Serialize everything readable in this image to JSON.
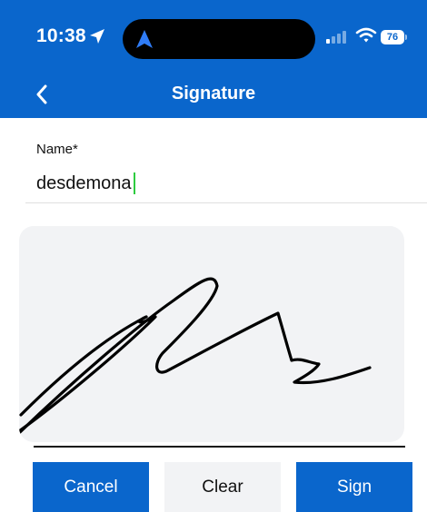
{
  "status_bar": {
    "time": "10:38",
    "battery": "76",
    "icons": [
      "location-arrow-icon",
      "navigation-icon",
      "signal-icon",
      "wifi-icon",
      "battery-icon"
    ]
  },
  "nav": {
    "title": "Signature",
    "back_icon": "chevron-left-icon"
  },
  "form": {
    "name_label": "Name*",
    "name_value": "desdemona"
  },
  "signature_pad": {
    "has_signature": true
  },
  "buttons": {
    "cancel": "Cancel",
    "clear": "Clear",
    "sign": "Sign"
  },
  "colors": {
    "primary": "#0a66cc",
    "pad_background": "#f2f3f5",
    "caret": "#2ecc40"
  }
}
